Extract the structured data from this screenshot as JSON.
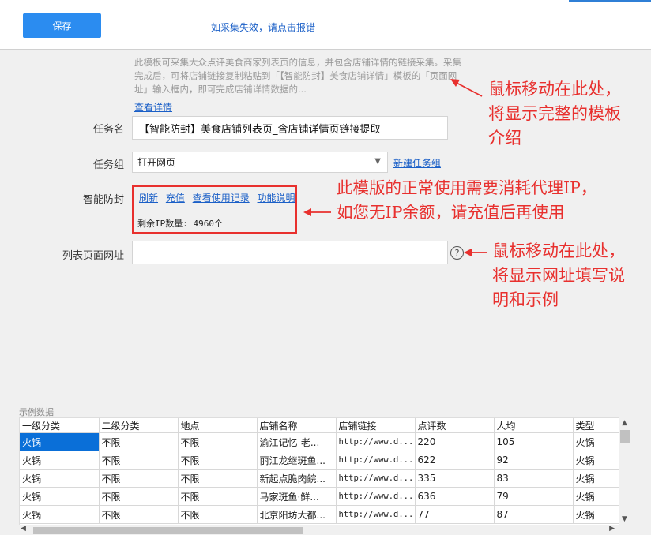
{
  "toolbar": {
    "save_label": "保存",
    "report_link": "如采集失效，请点击报错"
  },
  "template": {
    "description": "此模板可采集大众点评美食商家列表页的信息，并包含店铺详情的链接采集。采集完成后，可将店铺链接复制粘贴到「【智能防封】美食店铺详情」模板的「页面网址」输入框内，即可完成店铺详情数据的...",
    "details_link": "查看详情"
  },
  "form": {
    "task_name_label": "任务名",
    "task_name_value": "【智能防封】美食店铺列表页_含店铺详情页链接提取",
    "task_group_label": "任务组",
    "task_group_value": "打开网页",
    "new_group_link": "新建任务组",
    "anti_block_label": "智能防封",
    "anti_block_links": [
      "刷新",
      "充值",
      "查看使用记录",
      "功能说明"
    ],
    "ip_remaining": "剩余IP数量: 4960个",
    "list_url_label": "列表页面网址",
    "list_url_value": ""
  },
  "annotations": {
    "template_hint": [
      "鼠标移动在此处，",
      "将显示完整的模板",
      "介绍"
    ],
    "ip_hint": [
      "此模版的正常使用需要消耗代理IP，",
      "如您无IP余额，请充值后再使用"
    ],
    "url_hint": [
      "鼠标移动在此处，",
      "将显示网址填写说",
      "明和示例"
    ]
  },
  "sample": {
    "caption": "示例数据",
    "columns": [
      "一级分类",
      "二级分类",
      "地点",
      "店铺名称",
      "店铺链接",
      "点评数",
      "人均",
      "类型"
    ],
    "rows": [
      [
        "火锅",
        "不限",
        "不限",
        "渝江记忆-老...",
        "http://www.d...",
        "220",
        "105",
        "火锅"
      ],
      [
        "火锅",
        "不限",
        "不限",
        "丽江龙继斑鱼...",
        "http://www.d...",
        "622",
        "92",
        "火锅"
      ],
      [
        "火锅",
        "不限",
        "不限",
        "新起点脆肉鲩...",
        "http://www.d...",
        "335",
        "83",
        "火锅"
      ],
      [
        "火锅",
        "不限",
        "不限",
        "马家斑鱼·鲜...",
        "http://www.d...",
        "636",
        "79",
        "火锅"
      ],
      [
        "火锅",
        "不限",
        "不限",
        "北京阳坊大都...",
        "http://www.d...",
        "77",
        "87",
        "火锅"
      ]
    ]
  },
  "colors": {
    "primary_button": "#2b8cf0",
    "link": "#1a5fc7",
    "annotation_red": "#e8302e",
    "selected_cell": "#0a6fd8"
  },
  "icons": {
    "help": "question-circle-icon",
    "arrow": "red-arrow-icon"
  }
}
